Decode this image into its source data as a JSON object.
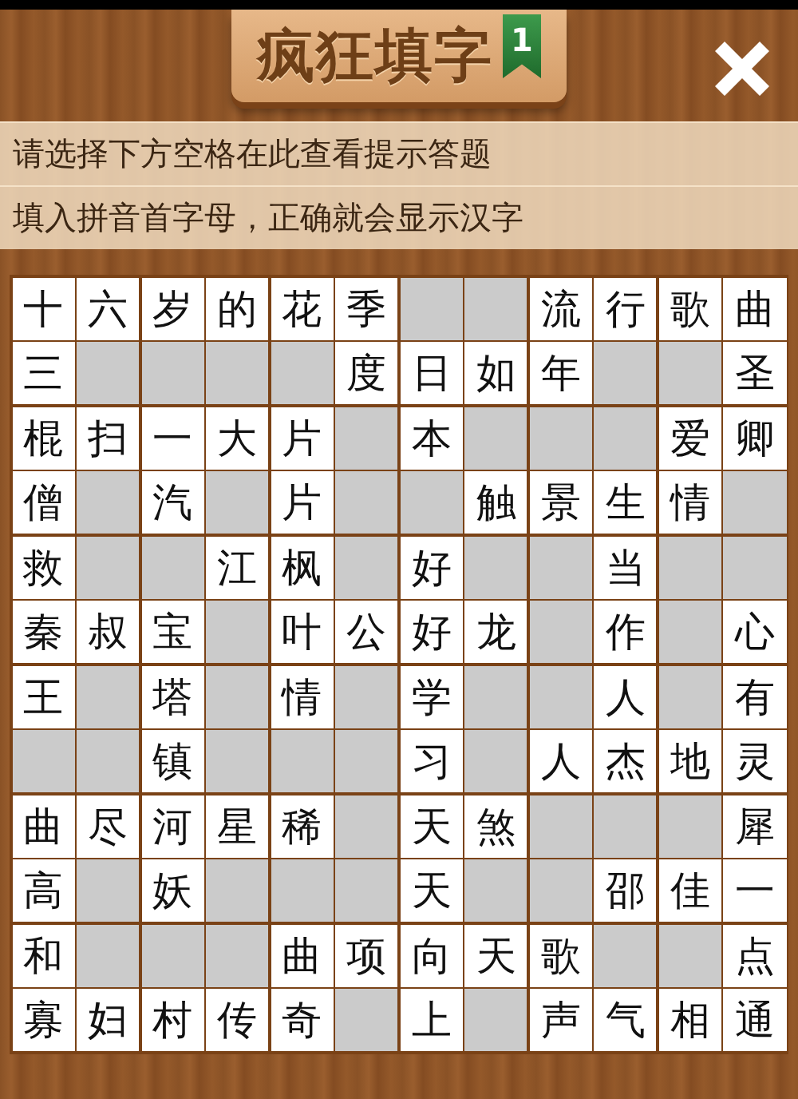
{
  "header": {
    "title": "疯狂填字",
    "level": "1"
  },
  "hints": [
    "请选择下方空格在此查看提示答题",
    "填入拼音首字母，正确就会显示汉字"
  ],
  "grid": [
    [
      {
        "blocked": false,
        "text": "十"
      },
      {
        "blocked": false,
        "text": "六"
      },
      {
        "blocked": false,
        "text": "岁"
      },
      {
        "blocked": false,
        "text": "的"
      },
      {
        "blocked": false,
        "text": "花"
      },
      {
        "blocked": false,
        "text": "季"
      },
      {
        "blocked": true
      },
      {
        "blocked": true
      },
      {
        "blocked": false,
        "text": "流"
      },
      {
        "blocked": false,
        "text": "行"
      },
      {
        "blocked": false,
        "text": "歌"
      },
      {
        "blocked": false,
        "text": "曲"
      }
    ],
    [
      {
        "blocked": false,
        "text": "三"
      },
      {
        "blocked": true
      },
      {
        "blocked": true
      },
      {
        "blocked": true
      },
      {
        "blocked": true
      },
      {
        "blocked": false,
        "text": "度"
      },
      {
        "blocked": false,
        "text": "日"
      },
      {
        "blocked": false,
        "text": "如"
      },
      {
        "blocked": false,
        "text": "年"
      },
      {
        "blocked": true
      },
      {
        "blocked": true
      },
      {
        "blocked": false,
        "text": "圣"
      }
    ],
    [
      {
        "blocked": false,
        "text": "棍"
      },
      {
        "blocked": false,
        "text": "扫"
      },
      {
        "blocked": false,
        "text": "一"
      },
      {
        "blocked": false,
        "text": "大"
      },
      {
        "blocked": false,
        "text": "片"
      },
      {
        "blocked": true
      },
      {
        "blocked": false,
        "text": "本"
      },
      {
        "blocked": true
      },
      {
        "blocked": true
      },
      {
        "blocked": true
      },
      {
        "blocked": false,
        "text": "爱"
      },
      {
        "blocked": false,
        "text": "卿"
      }
    ],
    [
      {
        "blocked": false,
        "text": "僧"
      },
      {
        "blocked": true
      },
      {
        "blocked": false,
        "text": "汽"
      },
      {
        "blocked": true
      },
      {
        "blocked": false,
        "text": "片"
      },
      {
        "blocked": true
      },
      {
        "blocked": true
      },
      {
        "blocked": false,
        "text": "触"
      },
      {
        "blocked": false,
        "text": "景"
      },
      {
        "blocked": false,
        "text": "生"
      },
      {
        "blocked": false,
        "text": "情"
      },
      {
        "blocked": true
      }
    ],
    [
      {
        "blocked": false,
        "text": "救"
      },
      {
        "blocked": true
      },
      {
        "blocked": true
      },
      {
        "blocked": false,
        "text": "江"
      },
      {
        "blocked": false,
        "text": "枫"
      },
      {
        "blocked": true
      },
      {
        "blocked": false,
        "text": "好"
      },
      {
        "blocked": true
      },
      {
        "blocked": true
      },
      {
        "blocked": false,
        "text": "当"
      },
      {
        "blocked": true
      },
      {
        "blocked": true
      }
    ],
    [
      {
        "blocked": false,
        "text": "秦"
      },
      {
        "blocked": false,
        "text": "叔"
      },
      {
        "blocked": false,
        "text": "宝"
      },
      {
        "blocked": true
      },
      {
        "blocked": false,
        "text": "叶"
      },
      {
        "blocked": false,
        "text": "公"
      },
      {
        "blocked": false,
        "text": "好"
      },
      {
        "blocked": false,
        "text": "龙"
      },
      {
        "blocked": true
      },
      {
        "blocked": false,
        "text": "作"
      },
      {
        "blocked": true
      },
      {
        "blocked": false,
        "text": "心"
      }
    ],
    [
      {
        "blocked": false,
        "text": "王"
      },
      {
        "blocked": true
      },
      {
        "blocked": false,
        "text": "塔"
      },
      {
        "blocked": true
      },
      {
        "blocked": false,
        "text": "情"
      },
      {
        "blocked": true
      },
      {
        "blocked": false,
        "text": "学"
      },
      {
        "blocked": true
      },
      {
        "blocked": true
      },
      {
        "blocked": false,
        "text": "人"
      },
      {
        "blocked": true
      },
      {
        "blocked": false,
        "text": "有"
      }
    ],
    [
      {
        "blocked": true
      },
      {
        "blocked": true
      },
      {
        "blocked": false,
        "text": "镇"
      },
      {
        "blocked": true
      },
      {
        "blocked": true
      },
      {
        "blocked": true
      },
      {
        "blocked": false,
        "text": "习"
      },
      {
        "blocked": true
      },
      {
        "blocked": false,
        "text": "人"
      },
      {
        "blocked": false,
        "text": "杰"
      },
      {
        "blocked": false,
        "text": "地"
      },
      {
        "blocked": false,
        "text": "灵"
      }
    ],
    [
      {
        "blocked": false,
        "text": "曲"
      },
      {
        "blocked": false,
        "text": "尽"
      },
      {
        "blocked": false,
        "text": "河"
      },
      {
        "blocked": false,
        "text": "星"
      },
      {
        "blocked": false,
        "text": "稀"
      },
      {
        "blocked": true
      },
      {
        "blocked": false,
        "text": "天"
      },
      {
        "blocked": false,
        "text": "煞"
      },
      {
        "blocked": true
      },
      {
        "blocked": true
      },
      {
        "blocked": true
      },
      {
        "blocked": false,
        "text": "犀"
      }
    ],
    [
      {
        "blocked": false,
        "text": "高"
      },
      {
        "blocked": true
      },
      {
        "blocked": false,
        "text": "妖"
      },
      {
        "blocked": true
      },
      {
        "blocked": true
      },
      {
        "blocked": true
      },
      {
        "blocked": false,
        "text": "天"
      },
      {
        "blocked": true
      },
      {
        "blocked": true
      },
      {
        "blocked": false,
        "text": "邵"
      },
      {
        "blocked": false,
        "text": "佳"
      },
      {
        "blocked": false,
        "text": "一"
      }
    ],
    [
      {
        "blocked": false,
        "text": "和"
      },
      {
        "blocked": true
      },
      {
        "blocked": true
      },
      {
        "blocked": true
      },
      {
        "blocked": false,
        "text": "曲"
      },
      {
        "blocked": false,
        "text": "项"
      },
      {
        "blocked": false,
        "text": "向"
      },
      {
        "blocked": false,
        "text": "天"
      },
      {
        "blocked": false,
        "text": "歌"
      },
      {
        "blocked": true
      },
      {
        "blocked": true
      },
      {
        "blocked": false,
        "text": "点"
      }
    ],
    [
      {
        "blocked": false,
        "text": "寡"
      },
      {
        "blocked": false,
        "text": "妇"
      },
      {
        "blocked": false,
        "text": "村"
      },
      {
        "blocked": false,
        "text": "传"
      },
      {
        "blocked": false,
        "text": "奇"
      },
      {
        "blocked": true
      },
      {
        "blocked": false,
        "text": "上"
      },
      {
        "blocked": true
      },
      {
        "blocked": false,
        "text": "声"
      },
      {
        "blocked": false,
        "text": "气"
      },
      {
        "blocked": false,
        "text": "相"
      },
      {
        "blocked": false,
        "text": "通"
      }
    ]
  ]
}
